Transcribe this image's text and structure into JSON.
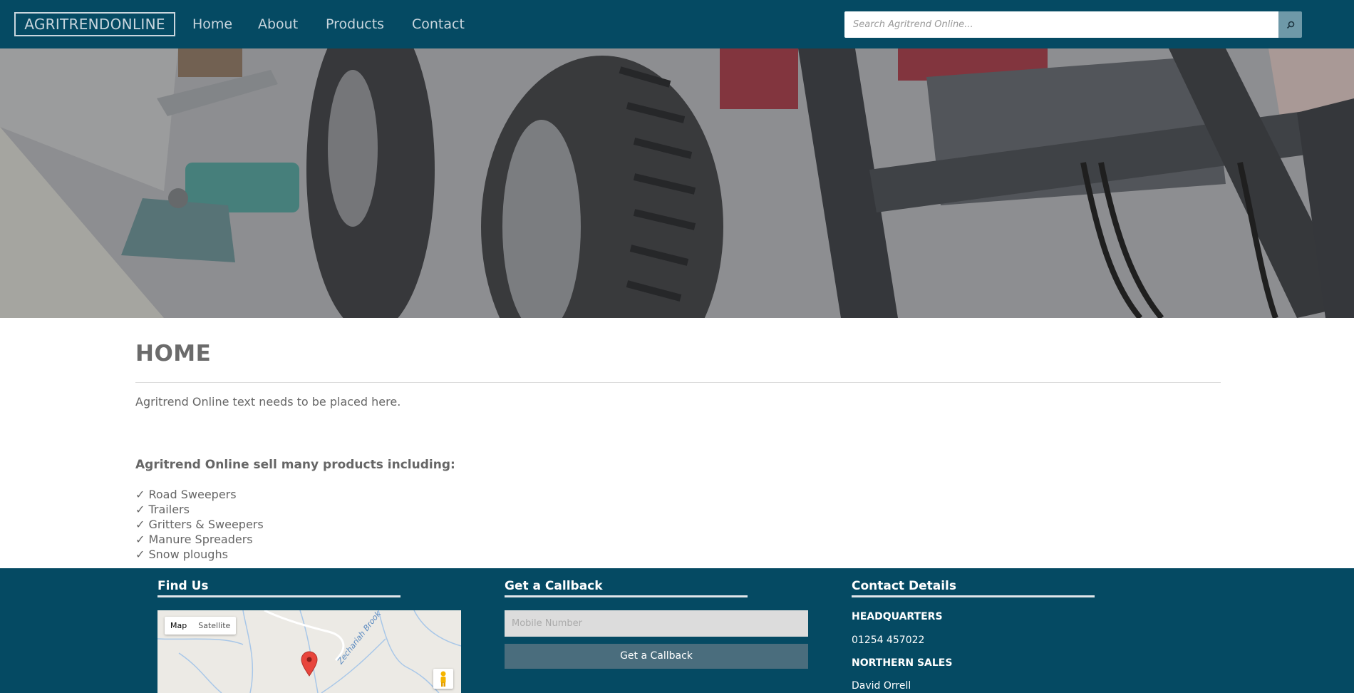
{
  "navbar": {
    "brand": "AGRITRENDONLINE",
    "links": [
      "Home",
      "About",
      "Products",
      "Contact"
    ],
    "search_placeholder": "Search Agritrend Online..."
  },
  "main": {
    "title": "HOME",
    "intro": "Agritrend Online text needs to be placed here.",
    "products_heading": "Agritrend Online sell many products including:",
    "products": [
      "✓ Road Sweepers",
      "✓ Trailers",
      "✓ Gritters & Sweepers",
      "✓ Manure Spreaders",
      "✓ Snow ploughs"
    ]
  },
  "footer": {
    "find_us": {
      "heading": "Find Us",
      "map_tabs": [
        "Map",
        "Satellite"
      ],
      "map_label": "Zechariah Brook"
    },
    "callback": {
      "heading": "Get a Callback",
      "mobile_placeholder": "Mobile Number",
      "button_label": "Get a Callback"
    },
    "contact": {
      "heading": "Contact Details",
      "hq_label": "HEADQUARTERS",
      "hq_phone": "01254 457022",
      "northern_label": "NORTHERN SALES",
      "northern_name": "David Orrell"
    }
  },
  "colors": {
    "navbar": "#054a63",
    "footer": "#054a63",
    "search_button": "#6e99a8",
    "callback_button": "#4a6d7d",
    "map_marker": "#e8453c"
  },
  "icons": {
    "search": "search-icon",
    "map_marker": "map-marker-icon",
    "pegman": "street-view-pegman-icon"
  }
}
